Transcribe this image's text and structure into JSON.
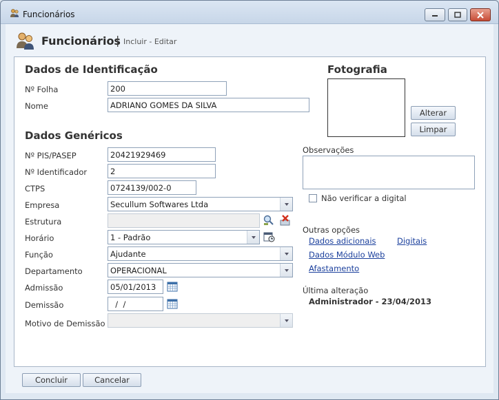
{
  "window": {
    "title": "Funcionários"
  },
  "header": {
    "title": "Funcionários",
    "separator": "|",
    "subtitle": "Incluir - Editar"
  },
  "identification": {
    "section_title": "Dados de Identificação",
    "folha_label": "Nº Folha",
    "folha_value": "200",
    "nome_label": "Nome",
    "nome_value": "ADRIANO GOMES DA SILVA"
  },
  "photo": {
    "section_title": "Fotografia",
    "alterar_label": "Alterar",
    "limpar_label": "Limpar"
  },
  "generic": {
    "section_title": "Dados Genéricos",
    "pis_label": "Nº PIS/PASEP",
    "pis_value": "20421929469",
    "identificador_label": "Nº Identificador",
    "identificador_value": "2",
    "ctps_label": "CTPS",
    "ctps_value": "0724139/002-0",
    "empresa_label": "Empresa",
    "empresa_value": "Secullum Softwares Ltda",
    "estrutura_label": "Estrutura",
    "estrutura_value": "",
    "horario_label": "Horário",
    "horario_value": "1 - Padrão",
    "funcao_label": "Função",
    "funcao_value": "Ajudante",
    "departamento_label": "Departamento",
    "departamento_value": "OPERACIONAL",
    "admissao_label": "Admissão",
    "admissao_value": "05/01/2013",
    "demissao_label": "Demissão",
    "demissao_value": "  /  /",
    "motivo_label": "Motivo de Demissão",
    "motivo_value": ""
  },
  "observacoes": {
    "label": "Observações",
    "value": ""
  },
  "digital": {
    "checkbox_label": "Não verificar a digital",
    "checked": false
  },
  "outras_opcoes": {
    "label": "Outras opções",
    "links": [
      "Dados adicionais",
      "Digitais",
      "Dados Módulo Web",
      "Afastamento"
    ]
  },
  "ultima_alteracao": {
    "label": "Última alteração",
    "value": "Administrador - 23/04/2013"
  },
  "footer": {
    "concluir_label": "Concluir",
    "cancelar_label": "Cancelar"
  },
  "icons": {
    "window_icon": "user-icon",
    "header_icon": "users-icon",
    "estrutura_search": "search-structure-icon",
    "estrutura_clear": "clear-icon",
    "horario_calendar": "schedule-icon",
    "admissao_calendar": "calendar-icon",
    "demissao_calendar": "calendar-icon"
  }
}
